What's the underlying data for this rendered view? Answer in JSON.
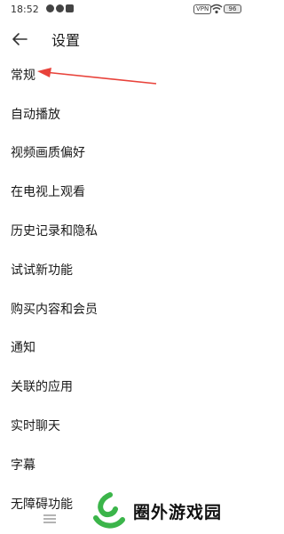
{
  "status_bar": {
    "time": "18:52",
    "vpn": "VPN",
    "battery": "96"
  },
  "header": {
    "title": "设置",
    "back_icon": "arrow-left-icon"
  },
  "settings": {
    "items": [
      {
        "label": "常规"
      },
      {
        "label": "自动播放"
      },
      {
        "label": "视频画质偏好"
      },
      {
        "label": "在电视上观看"
      },
      {
        "label": "历史记录和隐私"
      },
      {
        "label": "试试新功能"
      },
      {
        "label": "购买内容和会员"
      },
      {
        "label": "通知"
      },
      {
        "label": "关联的应用"
      },
      {
        "label": "实时聊天"
      },
      {
        "label": "字幕"
      },
      {
        "label": "无障碍功能"
      }
    ]
  },
  "watermark": {
    "text": "圈外游戏园"
  },
  "colors": {
    "annotation_arrow": "#e8423a",
    "watermark_green": "#3bb54a"
  }
}
